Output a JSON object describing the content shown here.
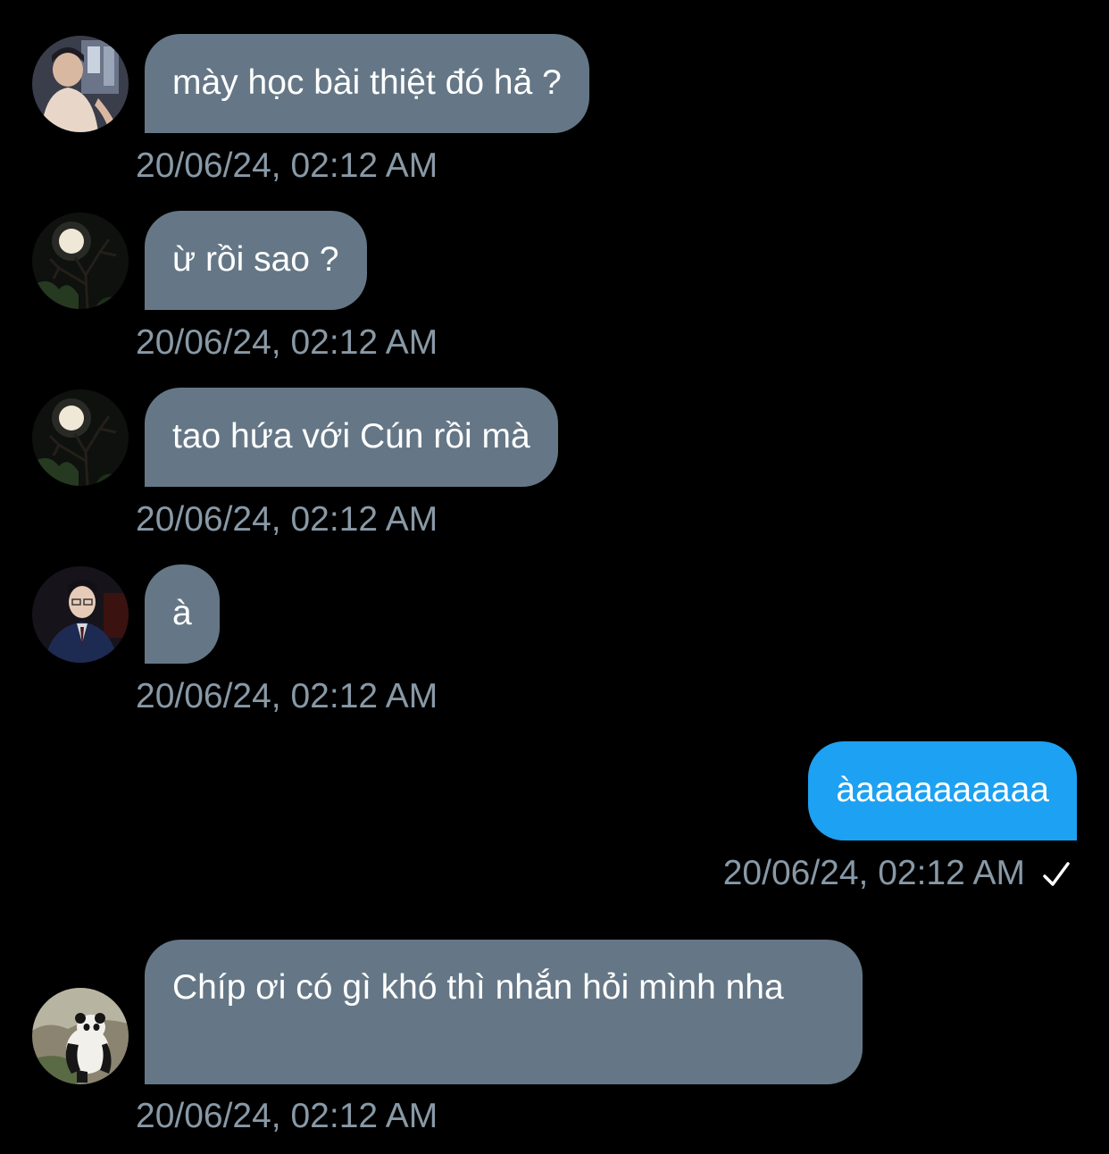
{
  "messages": [
    {
      "text": "mày học bài thiệt đó hả ?",
      "time": "20/06/24, 02:12 AM",
      "avatar": "person-avatar-1"
    },
    {
      "text": "ừ rồi sao ?",
      "time": "20/06/24, 02:12 AM",
      "avatar": "moon-tree-avatar"
    },
    {
      "text": "tao hứa với Cún rồi mà",
      "time": "20/06/24, 02:12 AM",
      "avatar": "moon-tree-avatar"
    },
    {
      "text": "à",
      "time": "20/06/24, 02:12 AM",
      "avatar": "suit-man-avatar"
    },
    {
      "text": "àaaaaaaaaaa",
      "time": "20/06/24, 02:12 AM",
      "sent": true,
      "status_icon": "check-icon"
    },
    {
      "text": "Chíp ơi có gì khó thì nhắn hỏi mình nha",
      "time": "20/06/24, 02:12 AM",
      "avatar": "panda-avatar"
    }
  ],
  "colors": {
    "background": "#000000",
    "incoming_bubble": "#657786",
    "outgoing_bubble": "#1da1f2",
    "timestamp": "#8899a6",
    "text": "#ffffff"
  }
}
